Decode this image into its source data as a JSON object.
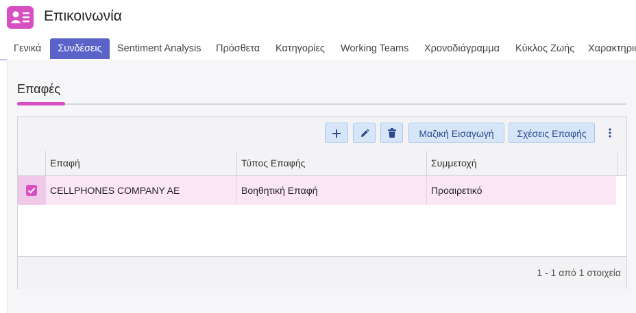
{
  "header": {
    "title": "Επικοινωνία",
    "icon": "contact-card-icon",
    "accent_color": "#d84fc2"
  },
  "tabs": [
    {
      "label": "Γενικά",
      "active": false
    },
    {
      "label": "Συνδέσεις",
      "active": true
    },
    {
      "label": "Sentiment Analysis",
      "active": false
    },
    {
      "label": "Πρόσθετα",
      "active": false
    },
    {
      "label": "Κατηγορίες",
      "active": false
    },
    {
      "label": "Working Teams",
      "active": false
    },
    {
      "label": "Χρονοδιάγραμμα",
      "active": false
    },
    {
      "label": "Κύκλος Ζωής",
      "active": false
    },
    {
      "label": "Χαρακτηριστικά",
      "active": false
    }
  ],
  "section": {
    "title": "Επαφές"
  },
  "toolbar": {
    "add_icon": "plus-icon",
    "edit_icon": "pencil-icon",
    "delete_icon": "trash-icon",
    "bulk_import_label": "Μαζική Εισαγωγή",
    "relations_label": "Σχέσεις Επαφής",
    "more_icon": "kebab-menu-icon"
  },
  "table": {
    "columns": [
      "Επαφή",
      "Τύπος Επαφής",
      "Συμμετοχή"
    ],
    "rows": [
      {
        "selected": true,
        "cells": [
          "CELLPHONES COMPANY AE",
          "Βοηθητική Επαφή",
          "Προαιρετικό"
        ]
      }
    ]
  },
  "pager": {
    "summary": "1 - 1 από 1 στοιχεία"
  }
}
